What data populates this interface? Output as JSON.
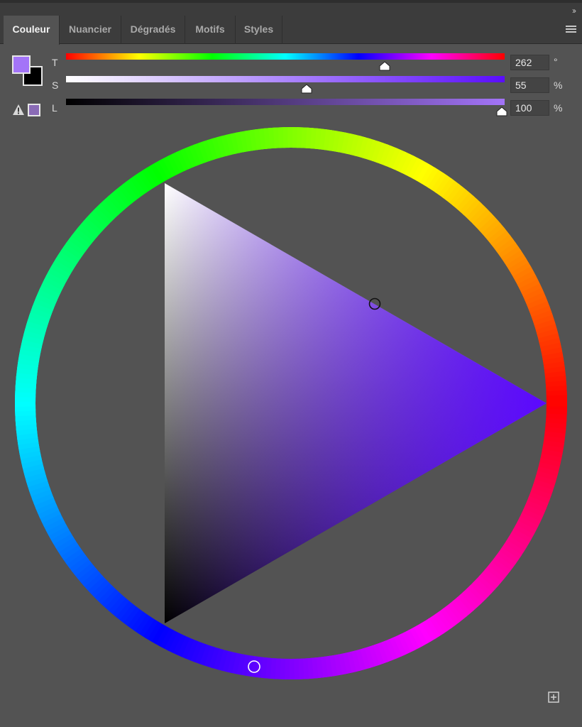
{
  "tabs": [
    {
      "label": "Couleur",
      "active": true
    },
    {
      "label": "Nuancier",
      "active": false
    },
    {
      "label": "Dégradés",
      "active": false
    },
    {
      "label": "Motifs",
      "active": false
    },
    {
      "label": "Styles",
      "active": false
    }
  ],
  "colors": {
    "foreground": "#a374f8",
    "background": "#000000",
    "gamut_swatch": "#8a6bb6",
    "panel": "#535353"
  },
  "sliders": {
    "hue": {
      "label": "T",
      "value": "262",
      "unit": "°",
      "fraction": 0.728
    },
    "saturation": {
      "label": "S",
      "value": "55",
      "unit": "%",
      "fraction": 0.55
    },
    "lightness": {
      "label": "L",
      "value": "100",
      "unit": "%",
      "fraction": 1.0
    }
  },
  "icons": {
    "collapse": "double-chevron-right-icon",
    "menu": "hamburger-menu-icon",
    "warning": "warning-triangle-icon",
    "add": "add-square-icon"
  }
}
